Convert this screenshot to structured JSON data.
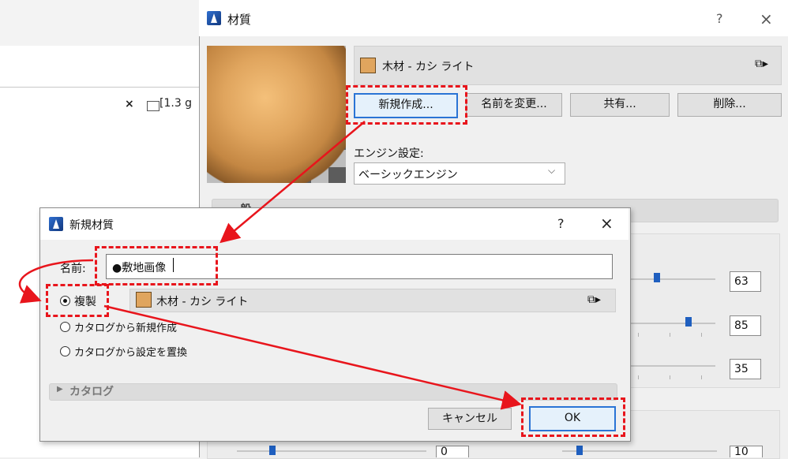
{
  "background": {
    "close_glyph": "×",
    "tab_label": "[1.3 g"
  },
  "material_window": {
    "title": "材質",
    "help": "?",
    "close": "×",
    "material_name": "木材 - カシ ライト",
    "buttons": {
      "new": "新規作成...",
      "rename": "名前を変更...",
      "share": "共有...",
      "delete": "削除..."
    },
    "engine_label": "エンジン設定:",
    "engine_value": "ベーシックエンジン",
    "section_general": "一般",
    "slider_values": [
      "63",
      "85",
      "35",
      "0",
      "10"
    ]
  },
  "new_material_dialog": {
    "title": "新規材質",
    "help": "?",
    "close": "×",
    "name_label": "名前:",
    "name_value": "●敷地画像",
    "options": {
      "duplicate": "複製",
      "new_from_catalog": "カタログから新規作成",
      "replace_from_catalog": "カタログから設定を置換"
    },
    "selected_option": "duplicate",
    "source_material": "木材 - カシ ライト",
    "catalog_section": "カタログ",
    "cancel": "キャンセル",
    "ok": "OK"
  },
  "colors": {
    "annotation_red": "#e8151c",
    "focus_blue": "#2a74d5",
    "wood_swatch": "#e0a55e"
  }
}
